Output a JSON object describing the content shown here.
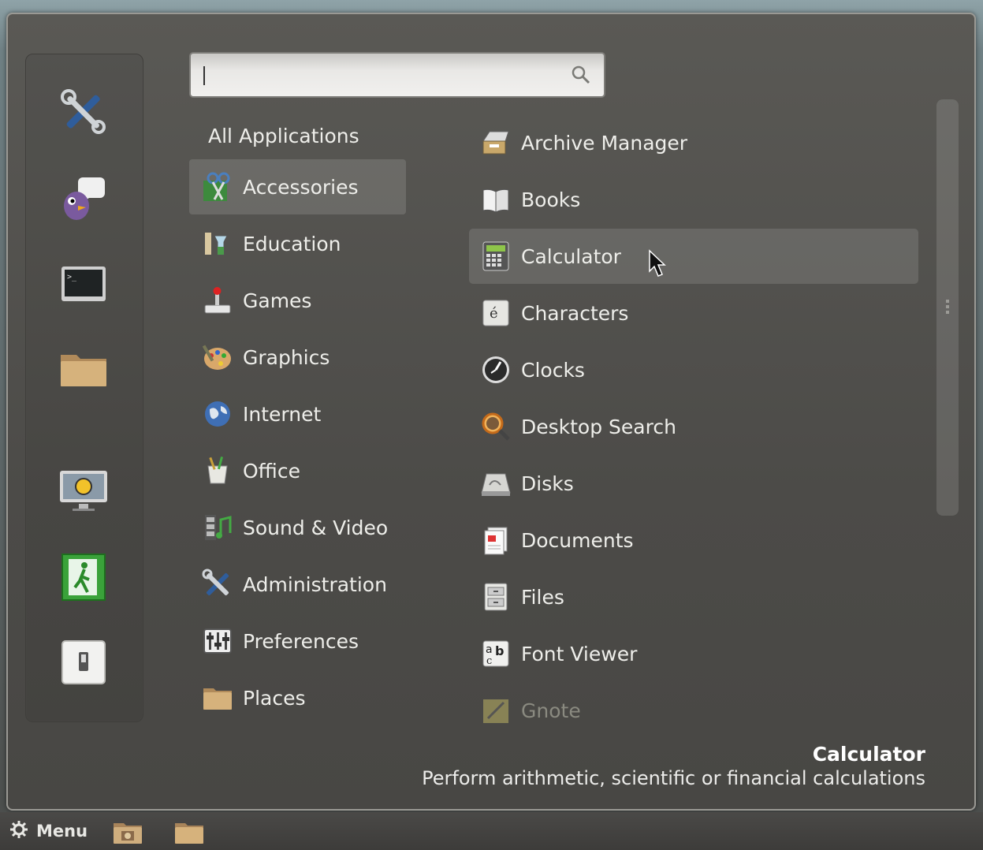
{
  "search": {
    "value": "",
    "placeholder": ""
  },
  "categories_header": "All Applications",
  "categories": [
    {
      "label": "Accessories",
      "icon": "accessories-icon",
      "selected": true
    },
    {
      "label": "Education",
      "icon": "education-icon"
    },
    {
      "label": "Games",
      "icon": "games-icon"
    },
    {
      "label": "Graphics",
      "icon": "graphics-icon"
    },
    {
      "label": "Internet",
      "icon": "internet-icon"
    },
    {
      "label": "Office",
      "icon": "office-icon"
    },
    {
      "label": "Sound & Video",
      "icon": "sound-video-icon"
    },
    {
      "label": "Administration",
      "icon": "administration-icon"
    },
    {
      "label": "Preferences",
      "icon": "preferences-icon"
    },
    {
      "label": "Places",
      "icon": "places-folder-icon"
    }
  ],
  "apps": [
    {
      "label": "Archive Manager",
      "icon": "archive-manager-icon"
    },
    {
      "label": "Books",
      "icon": "books-icon"
    },
    {
      "label": "Calculator",
      "icon": "calculator-icon",
      "selected": true
    },
    {
      "label": "Characters",
      "icon": "characters-icon"
    },
    {
      "label": "Clocks",
      "icon": "clocks-icon"
    },
    {
      "label": "Desktop Search",
      "icon": "desktop-search-icon"
    },
    {
      "label": "Disks",
      "icon": "disks-icon"
    },
    {
      "label": "Documents",
      "icon": "documents-icon"
    },
    {
      "label": "Files",
      "icon": "files-icon"
    },
    {
      "label": "Font Viewer",
      "icon": "font-viewer-icon"
    },
    {
      "label": "Gnote",
      "icon": "gnote-icon",
      "faded": true
    }
  ],
  "favorites": [
    "system-settings-icon",
    "pidgin-chat-icon",
    "terminal-icon",
    "folder-icon",
    "lock-screen-icon",
    "logout-icon",
    "shutdown-icon"
  ],
  "description": {
    "title": "Calculator",
    "text": "Perform arithmetic, scientific or financial calculations"
  },
  "taskbar": {
    "menu_label": "Menu"
  }
}
